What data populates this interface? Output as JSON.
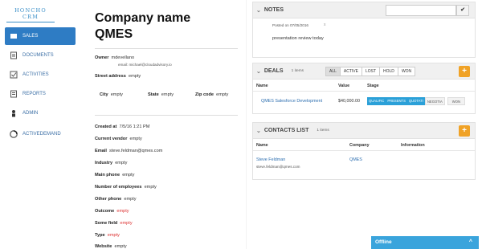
{
  "logo": "HONCHO CRM",
  "nav": [
    {
      "label": "SALES",
      "icon": "sales-icon"
    },
    {
      "label": "DOCUMENTS",
      "icon": "documents-icon"
    },
    {
      "label": "ACTIVITIES",
      "icon": "activities-icon"
    },
    {
      "label": "REPORTS",
      "icon": "reports-icon"
    },
    {
      "label": "ADMIN",
      "icon": "admin-icon"
    },
    {
      "label": "ACTIVEDEMAND",
      "icon": "activedemand-icon"
    }
  ],
  "company": {
    "label": "Company name",
    "name": "QMES",
    "owner_label": "Owner",
    "owner": "mdevellano",
    "owner_email": "email: michael@cloudadvisory.io",
    "street_label": "Street address",
    "street": "empty",
    "city_label": "City",
    "city": "empty",
    "state_label": "State",
    "state": "empty",
    "zip_label": "Zip code",
    "zip": "empty",
    "created_label": "Created at",
    "created": "7/5/16 1:21 PM",
    "vendor_label": "Current vendor",
    "vendor": "empty",
    "email_label": "Email",
    "email": "steve.feldman@qmes.com",
    "industry_label": "Industry",
    "industry": "empty",
    "phone_label": "Main phone",
    "phone": "empty",
    "employees_label": "Number of employees",
    "employees": "empty",
    "other_phone_label": "Other phone",
    "other_phone": "empty",
    "outcome_label": "Outcome",
    "outcome": "empty",
    "some_field_label": "Some field",
    "some_field": "empty",
    "type_label": "Type",
    "type": "empty",
    "website_label": "Website",
    "website": "empty"
  },
  "notes": {
    "title": "NOTES",
    "posted": "Posted on 07/05/2016",
    "close": "x",
    "text": "presentation review today",
    "submit_icon": "checkmark-icon"
  },
  "deals": {
    "title": "DEALS",
    "count": "1 items",
    "filters": [
      "ALL",
      "ACTIVE",
      "LOST",
      "HOLD",
      "WON"
    ],
    "active_filter": "ALL",
    "col_name": "Name",
    "col_value": "Value",
    "col_stage": "Stage",
    "row_name": "QMES Salesforce Development",
    "row_value": "$40,000.00",
    "stages": [
      "QUALIFIC",
      "PRESENTS",
      "QUOTATI",
      "NEGOTIA",
      "WON"
    ],
    "stage_colors": {
      "done": "#2ba0d8",
      "todo": "#f2f2f2"
    }
  },
  "contacts": {
    "title": "CONTACTS LIST",
    "count": "1 items",
    "col_name": "Name",
    "col_company": "Company",
    "col_info": "Information",
    "row_name": "Steve Feldman",
    "row_email": "steve.feldman@qmes.com",
    "row_company": "QMES"
  },
  "offline": {
    "label": "Offline",
    "caret": "^"
  }
}
